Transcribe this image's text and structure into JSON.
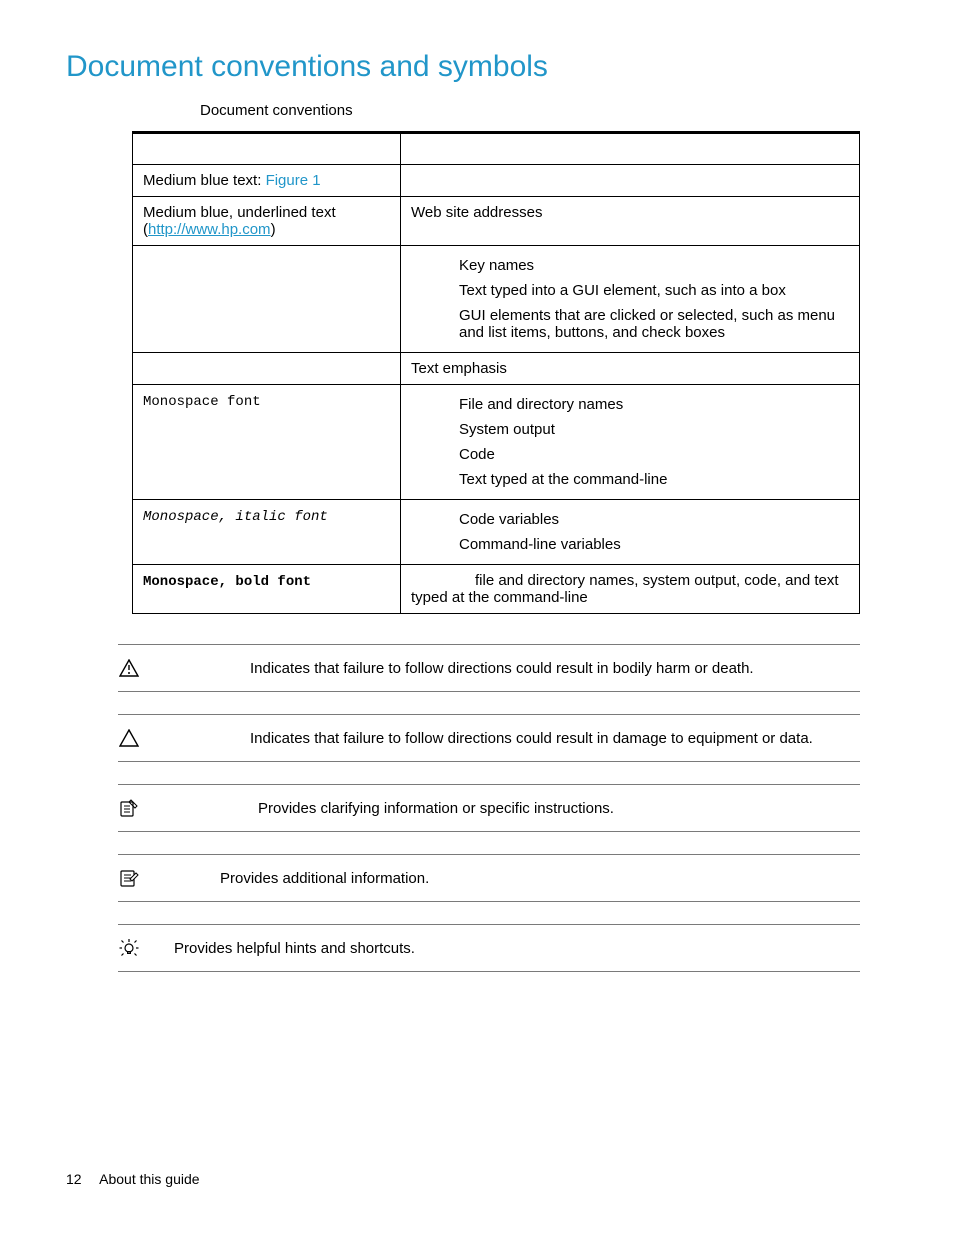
{
  "heading": "Document conventions and symbols",
  "table_caption": "Document conventions",
  "rows": {
    "r1_left_prefix": "Medium blue text: ",
    "r1_left_link": "Figure 1",
    "r1_right": "",
    "r2_left_line1": "Medium blue, underlined text",
    "r2_left_link": "http://www.hp.com",
    "r2_right": "Web site addresses",
    "r3_li1": "Key names",
    "r3_li2": "Text typed into a GUI element, such as into a box",
    "r3_li3": "GUI elements that are clicked or selected, such as menu and list items, buttons, and check boxes",
    "r4_right": "Text emphasis",
    "r5_left": "Monospace font",
    "r5_li1": "File and directory names",
    "r5_li2": "System output",
    "r5_li3": "Code",
    "r5_li4": "Text typed at the command-line",
    "r6_left": "Monospace, italic font",
    "r6_li1": "Code variables",
    "r6_li2": "Command-line variables",
    "r7_left": "Monospace, bold font",
    "r7_right": "file and directory names, system output, code, and text typed at the command-line"
  },
  "symbols": {
    "s1": "Indicates that failure to follow directions could result in bodily harm or death.",
    "s2": "Indicates that failure to follow directions could result in damage to equipment or data.",
    "s3": "Provides clarifying information or specific instructions.",
    "s4": "Provides additional information.",
    "s5": "Provides helpful hints and shortcuts."
  },
  "footer": {
    "page": "12",
    "section": "About this guide"
  }
}
